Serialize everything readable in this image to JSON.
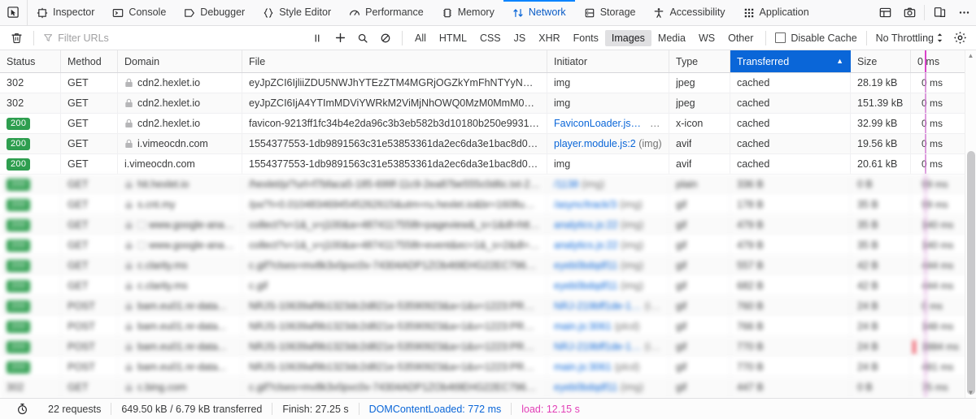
{
  "toolbox": {
    "picker_icon": "element-picker-icon",
    "tabs": [
      {
        "label": "Inspector",
        "icon": "inspector-icon",
        "selected": false
      },
      {
        "label": "Console",
        "icon": "console-icon",
        "selected": false
      },
      {
        "label": "Debugger",
        "icon": "debugger-icon",
        "selected": false
      },
      {
        "label": "Style Editor",
        "icon": "style-editor-icon",
        "selected": false
      },
      {
        "label": "Performance",
        "icon": "performance-icon",
        "selected": false
      },
      {
        "label": "Memory",
        "icon": "memory-icon",
        "selected": false
      },
      {
        "label": "Network",
        "icon": "network-icon",
        "selected": true
      },
      {
        "label": "Storage",
        "icon": "storage-icon",
        "selected": false
      },
      {
        "label": "Accessibility",
        "icon": "accessibility-icon",
        "selected": false
      },
      {
        "label": "Application",
        "icon": "application-icon",
        "selected": false
      }
    ],
    "right_icons": [
      {
        "name": "split-console-icon"
      },
      {
        "name": "camera-icon"
      },
      {
        "name": "responsive-design-mode-icon"
      },
      {
        "name": "more-options-icon"
      }
    ],
    "selected_tab_color": "#0a5cc6",
    "accent_color": "#0a84ff"
  },
  "net_toolbar": {
    "clear_icon": "trash-icon",
    "filter": {
      "icon": "funnel-icon",
      "placeholder": "Filter URLs",
      "value": ""
    },
    "action_icons": [
      {
        "name": "pause-icon"
      },
      {
        "name": "plus-icon"
      },
      {
        "name": "search-icon"
      },
      {
        "name": "block-icon"
      }
    ],
    "type_filters": [
      {
        "label": "All",
        "active": false
      },
      {
        "label": "HTML",
        "active": false
      },
      {
        "label": "CSS",
        "active": false
      },
      {
        "label": "JS",
        "active": false
      },
      {
        "label": "XHR",
        "active": false
      },
      {
        "label": "Fonts",
        "active": false
      },
      {
        "label": "Images",
        "active": true
      },
      {
        "label": "Media",
        "active": false
      },
      {
        "label": "WS",
        "active": false
      },
      {
        "label": "Other",
        "active": false
      }
    ],
    "disable_cache": {
      "label": "Disable Cache",
      "checked": false,
      "icon": "checkbox-icon"
    },
    "throttling": {
      "label": "No Throttling",
      "icon": "updown-chevron-icon"
    },
    "settings_icon": "gear-icon"
  },
  "table": {
    "columns": [
      {
        "key": "status",
        "label": "Status",
        "sorted": false
      },
      {
        "key": "method",
        "label": "Method",
        "sorted": false
      },
      {
        "key": "domain",
        "label": "Domain",
        "sorted": false
      },
      {
        "key": "file",
        "label": "File",
        "sorted": false
      },
      {
        "key": "initiator",
        "label": "Initiator",
        "sorted": false
      },
      {
        "key": "type",
        "label": "Type",
        "sorted": false
      },
      {
        "key": "transferred",
        "label": "Transferred",
        "sorted": true,
        "sort_dir": "asc",
        "sort_arrow": "▲"
      },
      {
        "key": "size",
        "label": "Size",
        "sorted": false
      },
      {
        "key": "waterfall",
        "label": "0 ms",
        "sorted": false
      }
    ],
    "sorted_header_bg": "#0a66d8",
    "status_badge_bg": "#2e9e4f",
    "rows": [
      {
        "status": "302",
        "status_badge": false,
        "method": "GET",
        "domain": "cdn2.hexlet.io",
        "secure": true,
        "favicon": false,
        "file": "eyJpZCI6IjliiZDU5NWJhYTEzZTM4MGRjOGZkYmFhNTYyNmM0Mjc3Lmpw",
        "initiator": "img",
        "initiator_link": "",
        "type": "jpeg",
        "transferred": "cached",
        "size": "28.19 kB",
        "waterfall": "0 ms",
        "blurred": false
      },
      {
        "status": "302",
        "status_badge": false,
        "method": "GET",
        "domain": "cdn2.hexlet.io",
        "secure": true,
        "favicon": false,
        "file": "eyJpZCI6IjA4YTImMDViYWRkM2ViMjNhOWQ0MzM0MmM0MzkxMzQzLi",
        "initiator": "img",
        "initiator_link": "",
        "type": "jpeg",
        "transferred": "cached",
        "size": "151.39 kB",
        "waterfall": "0 ms",
        "blurred": false
      },
      {
        "status": "200",
        "status_badge": true,
        "method": "GET",
        "domain": "cdn2.hexlet.io",
        "secure": true,
        "favicon": false,
        "file": "favicon-9213ff1fc34b4e2da96c3b3eb582b3d10180b250e993141d7928d6",
        "initiator": "(i...",
        "initiator_link": "FaviconLoader.jsm:180",
        "type": "x-icon",
        "transferred": "cached",
        "size": "32.99 kB",
        "waterfall": "0 ms",
        "blurred": false
      },
      {
        "status": "200",
        "status_badge": true,
        "method": "GET",
        "domain": "i.vimeocdn.com",
        "secure": true,
        "favicon": false,
        "file": "1554377553-1db9891563c31e53853361da2ec6da3e1bac8d014676d0438",
        "initiator": "(img)",
        "initiator_link": "player.module.js:2",
        "type": "avif",
        "transferred": "cached",
        "size": "19.56 kB",
        "waterfall": "0 ms",
        "blurred": false
      },
      {
        "status": "200",
        "status_badge": true,
        "method": "GET",
        "domain": "i.vimeocdn.com",
        "secure": false,
        "favicon": false,
        "file": "1554377553-1db9891563c31e53853361da2ec6da3e1bac8d014676d0438",
        "initiator": "img",
        "initiator_link": "",
        "type": "avif",
        "transferred": "cached",
        "size": "20.61 kB",
        "waterfall": "0 ms",
        "blurred": false
      },
      {
        "status": "200",
        "status_badge": true,
        "method": "GET",
        "domain": "hit.hexlet.io",
        "secure": true,
        "favicon": false,
        "file": "/hexlet/p/?url=f7bfaca5-185-699f-11c9-2ea87be555c0d6c.txt-21969f35",
        "initiator": "(img)",
        "initiator_link": "/1138",
        "type": "plain",
        "transferred": "336 B",
        "size": "0 B",
        "waterfall": "99 ms",
        "blurred": true
      },
      {
        "status": "200",
        "status_badge": true,
        "method": "GET",
        "domain": "s.cnt.my",
        "secure": true,
        "favicon": false,
        "file": "/px/?i=0.0104834694545262615&utm=ru.hexlet.io&br=1608ua=25609b.ck",
        "initiator": "(img)",
        "initiator_link": "/async/track/3",
        "type": "gif",
        "transferred": "178 B",
        "size": "35 B",
        "waterfall": "99 ms",
        "blurred": true
      },
      {
        "status": "200",
        "status_badge": true,
        "method": "GET",
        "domain": "www.google-analyt...",
        "secure": true,
        "favicon": true,
        "file": "collect?v=1&_v=j100&a=4874117558t=pageview&_s=1&dl=https://ru/",
        "initiator": "(img)",
        "initiator_link": "analytics.js:22",
        "type": "gif",
        "transferred": "479 B",
        "size": "35 B",
        "waterfall": "140 ms",
        "blurred": true
      },
      {
        "status": "200",
        "status_badge": true,
        "method": "GET",
        "domain": "www.google-analyt...",
        "secure": true,
        "favicon": true,
        "file": "collect?v=1&_v=j100&a=4874117558t=event&ec=1&_s=2&dl=https://ru",
        "initiator": "(img)",
        "initiator_link": "analytics.js:22",
        "type": "gif",
        "transferred": "479 B",
        "size": "35 B",
        "waterfall": "140 ms",
        "blurred": true
      },
      {
        "status": "200",
        "status_badge": true,
        "method": "GET",
        "domain": "c.clarity.ms",
        "secure": true,
        "favicon": false,
        "file": "c.gif?clses=mv8k3v0pvc0v-74304ADP1ZOb4t9EHG22EC79654CCAC0db9f42",
        "initiator": "(img)",
        "initiator_link": "eyeb0bdqdf11",
        "type": "gif",
        "transferred": "557 B",
        "size": "42 B",
        "waterfall": "444 ms",
        "blurred": true
      },
      {
        "status": "200",
        "status_badge": true,
        "method": "GET",
        "domain": "c.clarity.ms",
        "secure": true,
        "favicon": false,
        "file": "c.gif",
        "initiator": "(img)",
        "initiator_link": "eyeb0bdqdf11",
        "type": "gif",
        "transferred": "682 B",
        "size": "42 B",
        "waterfall": "444 ms",
        "blurred": true
      },
      {
        "status": "200",
        "status_badge": true,
        "method": "POST",
        "domain": "bam.eu01.nr-data...",
        "secure": true,
        "favicon": false,
        "file": "NRJS-10639af9b1323dc2d821e-53590923&a=1&v=1223:PRODb&t=Unnamed",
        "initiator": "(img)",
        "initiator_link": "NRJ-219bff1de-1223.js:1",
        "type": "gif",
        "transferred": "760 B",
        "size": "24 B",
        "waterfall": "0 ms",
        "blurred": true
      },
      {
        "status": "200",
        "status_badge": true,
        "method": "POST",
        "domain": "bam.eu01.nr-data...",
        "secure": true,
        "favicon": false,
        "file": "NRJS-10639af9b1323dc2d821e-53590923&a=1&v=1223:PRODb&t=Unnamed",
        "initiator": "(plcd)",
        "initiator_link": "main.js:3061",
        "type": "gif",
        "transferred": "766 B",
        "size": "24 B",
        "waterfall": "148 ms",
        "blurred": true
      },
      {
        "status": "200",
        "status_badge": true,
        "method": "POST",
        "domain": "bam.eu01.nr-data...",
        "secure": true,
        "favicon": false,
        "file": "NRJS-10639af9b1323dc2d821e-53590923&a=1&v=1223:PRODb&t=Unnamed",
        "initiator": "(img)",
        "initiator_link": "NRJ-219bff1de-1223.js:1",
        "type": "gif",
        "transferred": "770 B",
        "size": "24 B",
        "waterfall": "1884 ms",
        "blurred": true
      },
      {
        "status": "200",
        "status_badge": true,
        "method": "POST",
        "domain": "bam.eu01.nr-data...",
        "secure": true,
        "favicon": false,
        "file": "NRJS-10639af9b1323dc2d821e-53590923&a=1&v=1223:PRODb&t=Unnamed",
        "initiator": "(plcd)",
        "initiator_link": "main.js:3061",
        "type": "gif",
        "transferred": "770 B",
        "size": "24 B",
        "waterfall": "481 ms",
        "blurred": true
      },
      {
        "status": "302",
        "status_badge": false,
        "method": "GET",
        "domain": "c.bing.com",
        "secure": true,
        "favicon": false,
        "file": "c.gif?clses=mv8k3v0pvc0v-74304ADP1ZOb4t9EHG22EC79654CCAC0db9fa",
        "initiator": "(img)",
        "initiator_link": "eyeb0bdqdf11",
        "type": "gif",
        "transferred": "447 B",
        "size": "0 B",
        "waterfall": "75 ms",
        "blurred": true
      }
    ],
    "scrollbar": {
      "name": "vertical-scrollbar",
      "thumb_top_pct": 26,
      "thumb_height_pct": 70
    },
    "waterfall_marker_colors": {
      "dom_content_loaded": "#d943c9",
      "load": "#f05d6b"
    }
  },
  "statusbar": {
    "icon": "stopwatch-icon",
    "requests": "22 requests",
    "transferred": "649.50 kB / 6.79 kB transferred",
    "finish": "Finish: 27.25 s",
    "dom_content_loaded": "DOMContentLoaded: 772 ms",
    "load": "load: 12.15 s",
    "dcl_color": "#0a66d8",
    "load_color": "#e23fb7"
  }
}
